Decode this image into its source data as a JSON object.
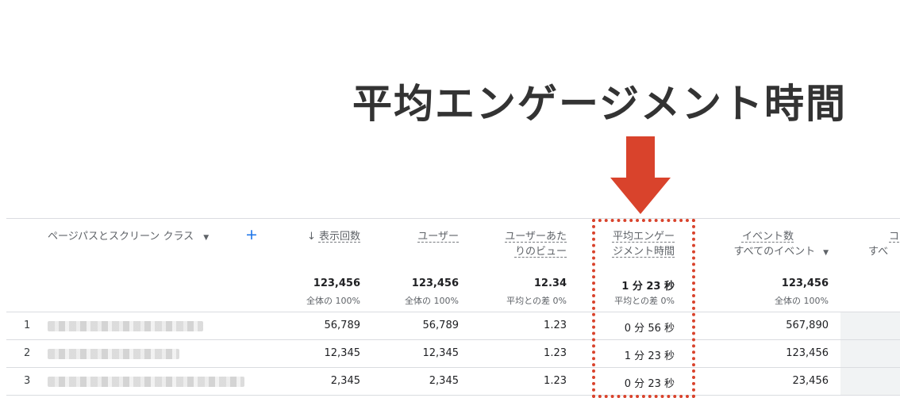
{
  "headline": "平均エンゲージメント時間",
  "colors": {
    "highlight": "#d9432c",
    "link": "#1a73e8"
  },
  "table": {
    "dimension": {
      "label": "ページパスとスクリーン クラス",
      "caret": "▼",
      "add": "+"
    },
    "columns": {
      "views": {
        "sort": "↓",
        "line1": "表示回数"
      },
      "users": {
        "line1": "ユーザー"
      },
      "views_per": {
        "line1": "ユーザーあた",
        "line2": "りのビュー"
      },
      "engagement": {
        "line1": "平均エンゲー",
        "line2": "ジメント時間"
      },
      "events": {
        "line1": "イベント数",
        "line2": "すべてのイベント",
        "caret": "▼"
      },
      "next": {
        "line1": "コ",
        "line2": "すべ"
      }
    },
    "totals": {
      "views": {
        "value": "123,456",
        "sub": "全体の 100%"
      },
      "users": {
        "value": "123,456",
        "sub": "全体の 100%"
      },
      "views_per": {
        "value": "12.34",
        "sub": "平均との差 0%"
      },
      "engagement": {
        "value": "1 分 23 秒",
        "sub": "平均との差 0%"
      },
      "events": {
        "value": "123,456",
        "sub": "全体の 100%"
      }
    },
    "rows": [
      {
        "num": "1",
        "views": "56,789",
        "users": "56,789",
        "views_per": "1.23",
        "engagement": "0 分 56 秒",
        "events": "567,890"
      },
      {
        "num": "2",
        "views": "12,345",
        "users": "12,345",
        "views_per": "1.23",
        "engagement": "1 分 23 秒",
        "events": "123,456"
      },
      {
        "num": "3",
        "views": "2,345",
        "users": "2,345",
        "views_per": "1.23",
        "engagement": "0 分 23 秒",
        "events": "23,456"
      }
    ]
  }
}
